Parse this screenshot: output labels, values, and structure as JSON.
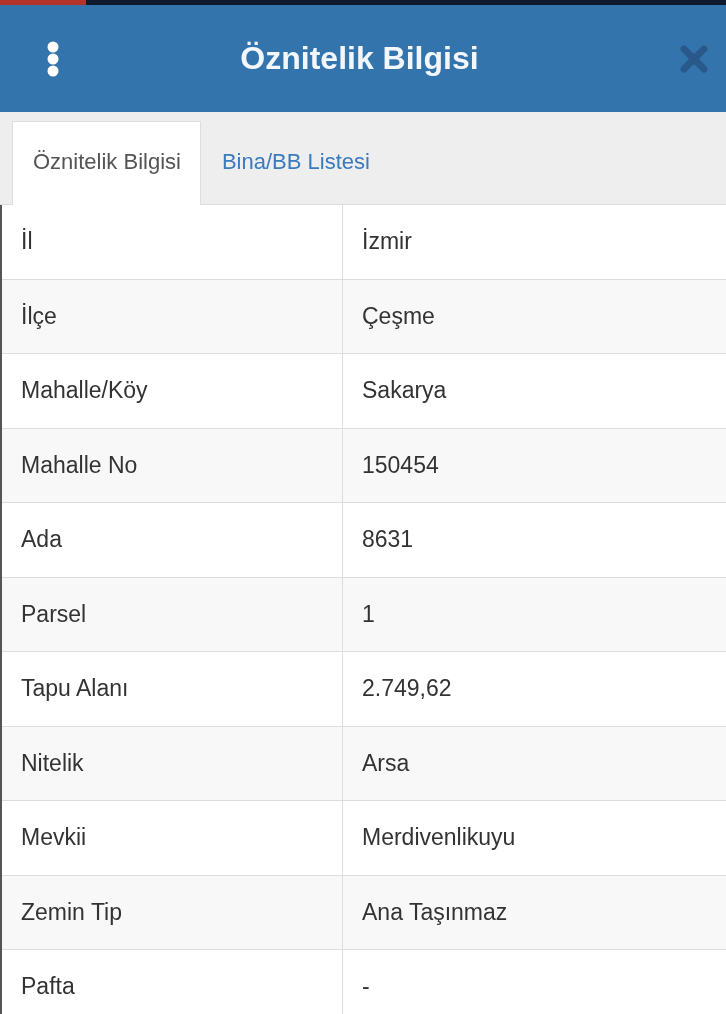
{
  "header": {
    "title": "Öznitelik Bilgisi"
  },
  "tabs": [
    {
      "label": "Öznitelik Bilgisi",
      "selected": true
    },
    {
      "label": "Bina/BB Listesi",
      "selected": false
    }
  ],
  "table": {
    "rows": [
      {
        "label": "İl",
        "value": "İzmir"
      },
      {
        "label": "İlçe",
        "value": "Çeşme"
      },
      {
        "label": "Mahalle/Köy",
        "value": "Sakarya"
      },
      {
        "label": "Mahalle No",
        "value": "150454"
      },
      {
        "label": "Ada",
        "value": "8631"
      },
      {
        "label": "Parsel",
        "value": "1"
      },
      {
        "label": "Tapu Alanı",
        "value": "2.749,62"
      },
      {
        "label": "Nitelik",
        "value": "Arsa"
      },
      {
        "label": "Mevkii",
        "value": "Merdivenlikuyu"
      },
      {
        "label": "Zemin Tip",
        "value": "Ana Taşınmaz"
      },
      {
        "label": "Pafta",
        "value": "-"
      }
    ]
  }
}
